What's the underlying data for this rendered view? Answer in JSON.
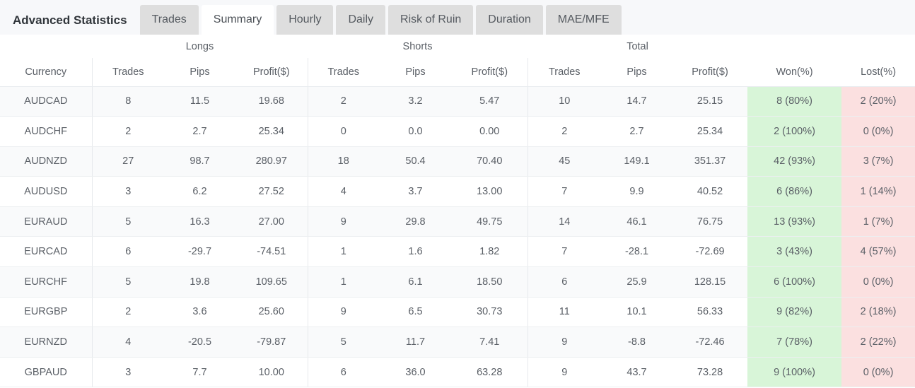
{
  "tabs": [
    {
      "label": "Advanced Statistics",
      "kind": "title",
      "active": false
    },
    {
      "label": "Trades",
      "kind": "tab",
      "active": false
    },
    {
      "label": "Summary",
      "kind": "tab",
      "active": true
    },
    {
      "label": "Hourly",
      "kind": "tab",
      "active": false
    },
    {
      "label": "Daily",
      "kind": "tab",
      "active": false
    },
    {
      "label": "Risk of Ruin",
      "kind": "tab",
      "active": false
    },
    {
      "label": "Duration",
      "kind": "tab",
      "active": false
    },
    {
      "label": "MAE/MFE",
      "kind": "tab",
      "active": false
    }
  ],
  "table": {
    "group_headers": {
      "currency": "",
      "longs": "Longs",
      "shorts": "Shorts",
      "total": "Total",
      "won": "",
      "lost": ""
    },
    "column_headers": [
      "Currency",
      "Trades",
      "Pips",
      "Profit($)",
      "Trades",
      "Pips",
      "Profit($)",
      "Trades",
      "Pips",
      "Profit($)",
      "Won(%)",
      "Lost(%)"
    ],
    "colors": {
      "positive": "#2eab4a",
      "negative": "#f2514b",
      "neutral": "#5a5f66",
      "won_cell_bg": "#d8f5d8",
      "lost_cell_bg": "#fbe0e0"
    },
    "rows": [
      {
        "currency": "AUDCAD",
        "long_trades": "8",
        "long_pips": "11.5",
        "long_pips_sign": "pos",
        "long_profit": "19.68",
        "long_profit_sign": "pos",
        "short_trades": "2",
        "short_pips": "3.2",
        "short_pips_sign": "pos",
        "short_profit": "5.47",
        "short_profit_sign": "pos",
        "total_trades": "10",
        "total_pips": "14.7",
        "total_pips_sign": "pos",
        "total_profit": "25.15",
        "total_profit_sign": "pos",
        "won": "8 (80%)",
        "lost": "2 (20%)"
      },
      {
        "currency": "AUDCHF",
        "long_trades": "2",
        "long_pips": "2.7",
        "long_pips_sign": "pos",
        "long_profit": "25.34",
        "long_profit_sign": "pos",
        "short_trades": "0",
        "short_pips": "0.0",
        "short_pips_sign": "pos",
        "short_profit": "0.00",
        "short_profit_sign": "neu",
        "total_trades": "2",
        "total_pips": "2.7",
        "total_pips_sign": "pos",
        "total_profit": "25.34",
        "total_profit_sign": "pos",
        "won": "2 (100%)",
        "lost": "0 (0%)"
      },
      {
        "currency": "AUDNZD",
        "long_trades": "27",
        "long_pips": "98.7",
        "long_pips_sign": "pos",
        "long_profit": "280.97",
        "long_profit_sign": "pos",
        "short_trades": "18",
        "short_pips": "50.4",
        "short_pips_sign": "pos",
        "short_profit": "70.40",
        "short_profit_sign": "pos",
        "total_trades": "45",
        "total_pips": "149.1",
        "total_pips_sign": "pos",
        "total_profit": "351.37",
        "total_profit_sign": "pos",
        "won": "42 (93%)",
        "lost": "3 (7%)"
      },
      {
        "currency": "AUDUSD",
        "long_trades": "3",
        "long_pips": "6.2",
        "long_pips_sign": "pos",
        "long_profit": "27.52",
        "long_profit_sign": "pos",
        "short_trades": "4",
        "short_pips": "3.7",
        "short_pips_sign": "pos",
        "short_profit": "13.00",
        "short_profit_sign": "pos",
        "total_trades": "7",
        "total_pips": "9.9",
        "total_pips_sign": "pos",
        "total_profit": "40.52",
        "total_profit_sign": "pos",
        "won": "6 (86%)",
        "lost": "1 (14%)"
      },
      {
        "currency": "EURAUD",
        "long_trades": "5",
        "long_pips": "16.3",
        "long_pips_sign": "pos",
        "long_profit": "27.00",
        "long_profit_sign": "pos",
        "short_trades": "9",
        "short_pips": "29.8",
        "short_pips_sign": "pos",
        "short_profit": "49.75",
        "short_profit_sign": "pos",
        "total_trades": "14",
        "total_pips": "46.1",
        "total_pips_sign": "pos",
        "total_profit": "76.75",
        "total_profit_sign": "pos",
        "won": "13 (93%)",
        "lost": "1 (7%)"
      },
      {
        "currency": "EURCAD",
        "long_trades": "6",
        "long_pips": "-29.7",
        "long_pips_sign": "neg",
        "long_profit": "-74.51",
        "long_profit_sign": "neg",
        "short_trades": "1",
        "short_pips": "1.6",
        "short_pips_sign": "pos",
        "short_profit": "1.82",
        "short_profit_sign": "pos",
        "total_trades": "7",
        "total_pips": "-28.1",
        "total_pips_sign": "neg",
        "total_profit": "-72.69",
        "total_profit_sign": "neg",
        "won": "3 (43%)",
        "lost": "4 (57%)"
      },
      {
        "currency": "EURCHF",
        "long_trades": "5",
        "long_pips": "19.8",
        "long_pips_sign": "pos",
        "long_profit": "109.65",
        "long_profit_sign": "pos",
        "short_trades": "1",
        "short_pips": "6.1",
        "short_pips_sign": "pos",
        "short_profit": "18.50",
        "short_profit_sign": "pos",
        "total_trades": "6",
        "total_pips": "25.9",
        "total_pips_sign": "pos",
        "total_profit": "128.15",
        "total_profit_sign": "pos",
        "won": "6 (100%)",
        "lost": "0 (0%)"
      },
      {
        "currency": "EURGBP",
        "long_trades": "2",
        "long_pips": "3.6",
        "long_pips_sign": "pos",
        "long_profit": "25.60",
        "long_profit_sign": "pos",
        "short_trades": "9",
        "short_pips": "6.5",
        "short_pips_sign": "pos",
        "short_profit": "30.73",
        "short_profit_sign": "pos",
        "total_trades": "11",
        "total_pips": "10.1",
        "total_pips_sign": "pos",
        "total_profit": "56.33",
        "total_profit_sign": "pos",
        "won": "9 (82%)",
        "lost": "2 (18%)"
      },
      {
        "currency": "EURNZD",
        "long_trades": "4",
        "long_pips": "-20.5",
        "long_pips_sign": "neg",
        "long_profit": "-79.87",
        "long_profit_sign": "neg",
        "short_trades": "5",
        "short_pips": "11.7",
        "short_pips_sign": "pos",
        "short_profit": "7.41",
        "short_profit_sign": "pos",
        "total_trades": "9",
        "total_pips": "-8.8",
        "total_pips_sign": "neg",
        "total_profit": "-72.46",
        "total_profit_sign": "neg",
        "won": "7 (78%)",
        "lost": "2 (22%)"
      },
      {
        "currency": "GBPAUD",
        "long_trades": "3",
        "long_pips": "7.7",
        "long_pips_sign": "pos",
        "long_profit": "10.00",
        "long_profit_sign": "pos",
        "short_trades": "6",
        "short_pips": "36.0",
        "short_pips_sign": "pos",
        "short_profit": "63.28",
        "short_profit_sign": "pos",
        "total_trades": "9",
        "total_pips": "43.7",
        "total_pips_sign": "pos",
        "total_profit": "73.28",
        "total_profit_sign": "pos",
        "won": "9 (100%)",
        "lost": "0 (0%)"
      }
    ]
  }
}
